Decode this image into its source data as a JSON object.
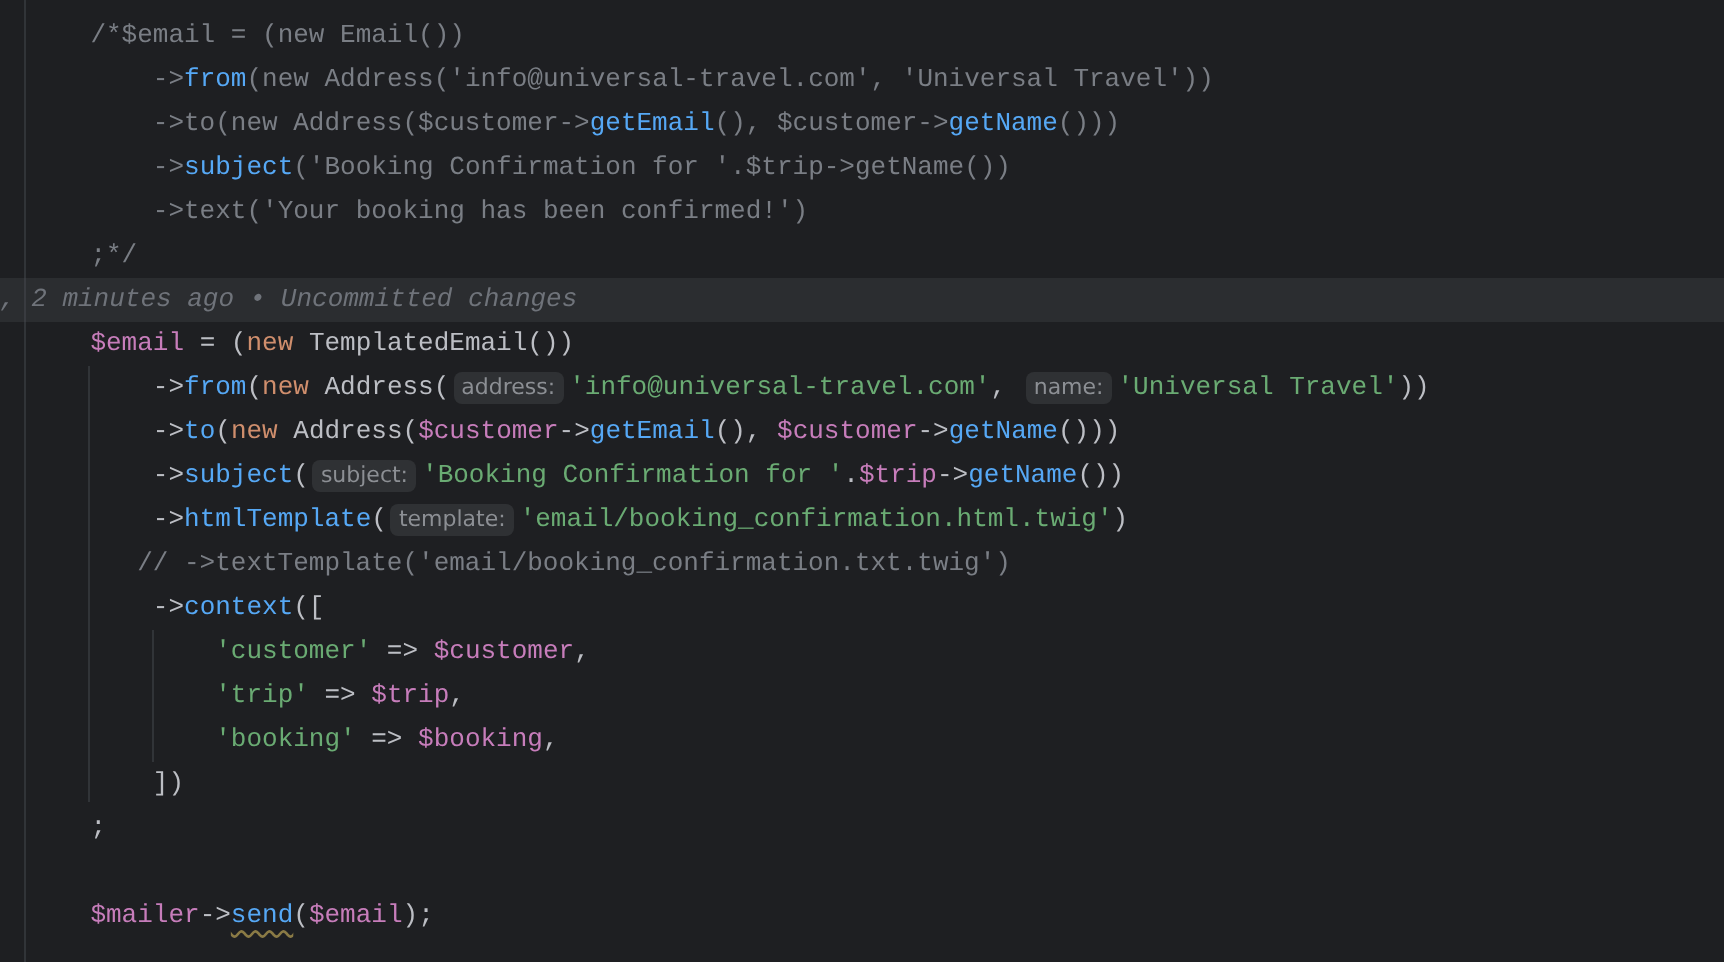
{
  "editor": {
    "lines": [
      {
        "kind": "code",
        "tokens": [
          {
            "kind": "comment",
            "t": "/*$email = (new Email())"
          }
        ],
        "children": [
          {
            "kind": "code",
            "tokens": [
              {
                "kind": "comment",
                "t": "->"
              },
              {
                "kind": "method",
                "t": "from"
              },
              {
                "kind": "comment",
                "t": "(new Address('info@universal-travel.com', 'Universal Travel'))"
              }
            ]
          },
          {
            "kind": "code",
            "tokens": [
              {
                "kind": "comment",
                "t": "->to(new Address($customer->"
              },
              {
                "kind": "method",
                "t": "getEmail"
              },
              {
                "kind": "comment",
                "t": "(), $customer->"
              },
              {
                "kind": "method",
                "t": "getName"
              },
              {
                "kind": "comment",
                "t": "()))"
              }
            ]
          },
          {
            "kind": "code",
            "tokens": [
              {
                "kind": "comment",
                "t": "->"
              },
              {
                "kind": "method",
                "t": "subject"
              },
              {
                "kind": "comment",
                "t": "('Booking Confirmation for '.$trip->getName())"
              }
            ]
          },
          {
            "kind": "code",
            "tokens": [
              {
                "kind": "comment",
                "t": "->text('Your booking has been confirmed!')"
              }
            ]
          }
        ]
      },
      {
        "kind": "code",
        "tokens": [
          {
            "kind": "comment",
            "t": ";*/"
          }
        ]
      },
      {
        "kind": "blame",
        "text": ", 2 minutes ago • Uncommitted changes"
      },
      {
        "kind": "code",
        "tokens": [
          {
            "kind": "var",
            "t": "$email"
          },
          {
            "kind": "code",
            "t": " = ("
          },
          {
            "kind": "keyword",
            "t": "new"
          },
          {
            "kind": "code",
            "t": " TemplatedEmail())"
          }
        ],
        "children": [
          {
            "kind": "code",
            "tokens": [
              {
                "kind": "code",
                "t": "->"
              },
              {
                "kind": "method",
                "t": "from"
              },
              {
                "kind": "code",
                "t": "("
              },
              {
                "kind": "keyword",
                "t": "new"
              },
              {
                "kind": "code",
                "t": " Address("
              },
              {
                "kind": "hint",
                "t": "address:"
              },
              {
                "kind": "string",
                "t": "'info@universal-travel.com'"
              },
              {
                "kind": "code",
                "t": ", "
              },
              {
                "kind": "hint",
                "t": "name:"
              },
              {
                "kind": "string",
                "t": "'Universal Travel'"
              },
              {
                "kind": "code",
                "t": "))"
              }
            ]
          },
          {
            "kind": "code",
            "tokens": [
              {
                "kind": "code",
                "t": "->"
              },
              {
                "kind": "method",
                "t": "to"
              },
              {
                "kind": "code",
                "t": "("
              },
              {
                "kind": "keyword",
                "t": "new"
              },
              {
                "kind": "code",
                "t": " Address("
              },
              {
                "kind": "var",
                "t": "$customer"
              },
              {
                "kind": "code",
                "t": "->"
              },
              {
                "kind": "method",
                "t": "getEmail"
              },
              {
                "kind": "code",
                "t": "(), "
              },
              {
                "kind": "var",
                "t": "$customer"
              },
              {
                "kind": "code",
                "t": "->"
              },
              {
                "kind": "method",
                "t": "getName"
              },
              {
                "kind": "code",
                "t": "()))"
              }
            ]
          },
          {
            "kind": "code",
            "tokens": [
              {
                "kind": "code",
                "t": "->"
              },
              {
                "kind": "method",
                "t": "subject"
              },
              {
                "kind": "code",
                "t": "("
              },
              {
                "kind": "hint",
                "t": "subject:"
              },
              {
                "kind": "string",
                "t": "'Booking Confirmation for '"
              },
              {
                "kind": "code",
                "t": "."
              },
              {
                "kind": "var",
                "t": "$trip"
              },
              {
                "kind": "code",
                "t": "->"
              },
              {
                "kind": "method",
                "t": "getName"
              },
              {
                "kind": "code",
                "t": "())"
              }
            ]
          },
          {
            "kind": "code",
            "tokens": [
              {
                "kind": "code",
                "t": "->"
              },
              {
                "kind": "method",
                "t": "htmlTemplate"
              },
              {
                "kind": "code",
                "t": "("
              },
              {
                "kind": "hint",
                "t": "template:"
              },
              {
                "kind": "string",
                "t": "'email/booking_confirmation.html.twig'"
              },
              {
                "kind": "code",
                "t": ")"
              }
            ]
          },
          {
            "kind": "line-comment",
            "tokens": [
              {
                "kind": "comment",
                "t": "// ->textTemplate('email/booking_confirmation.txt.twig')"
              }
            ]
          },
          {
            "kind": "code",
            "tokens": [
              {
                "kind": "code",
                "t": "->"
              },
              {
                "kind": "method",
                "t": "context"
              },
              {
                "kind": "code",
                "t": "(["
              }
            ],
            "children": [
              {
                "kind": "code",
                "tokens": [
                  {
                    "kind": "string",
                    "t": "'customer'"
                  },
                  {
                    "kind": "code",
                    "t": " => "
                  },
                  {
                    "kind": "var",
                    "t": "$customer"
                  },
                  {
                    "kind": "code",
                    "t": ","
                  }
                ]
              },
              {
                "kind": "code",
                "tokens": [
                  {
                    "kind": "string",
                    "t": "'trip'"
                  },
                  {
                    "kind": "code",
                    "t": " => "
                  },
                  {
                    "kind": "var",
                    "t": "$trip"
                  },
                  {
                    "kind": "code",
                    "t": ","
                  }
                ]
              },
              {
                "kind": "code",
                "tokens": [
                  {
                    "kind": "string",
                    "t": "'booking'"
                  },
                  {
                    "kind": "code",
                    "t": " => "
                  },
                  {
                    "kind": "var",
                    "t": "$booking"
                  },
                  {
                    "kind": "code",
                    "t": ","
                  }
                ]
              }
            ]
          },
          {
            "kind": "code",
            "tokens": [
              {
                "kind": "code",
                "t": "])"
              }
            ]
          }
        ]
      },
      {
        "kind": "code",
        "tokens": [
          {
            "kind": "code",
            "t": ";"
          }
        ]
      },
      {
        "kind": "blank"
      },
      {
        "kind": "code",
        "tokens": [
          {
            "kind": "var",
            "t": "$mailer"
          },
          {
            "kind": "code",
            "t": "->"
          },
          {
            "kind": "method",
            "t": "send",
            "warning": true
          },
          {
            "kind": "code",
            "t": "("
          },
          {
            "kind": "var",
            "t": "$email"
          },
          {
            "kind": "code",
            "t": ");"
          }
        ]
      }
    ]
  }
}
